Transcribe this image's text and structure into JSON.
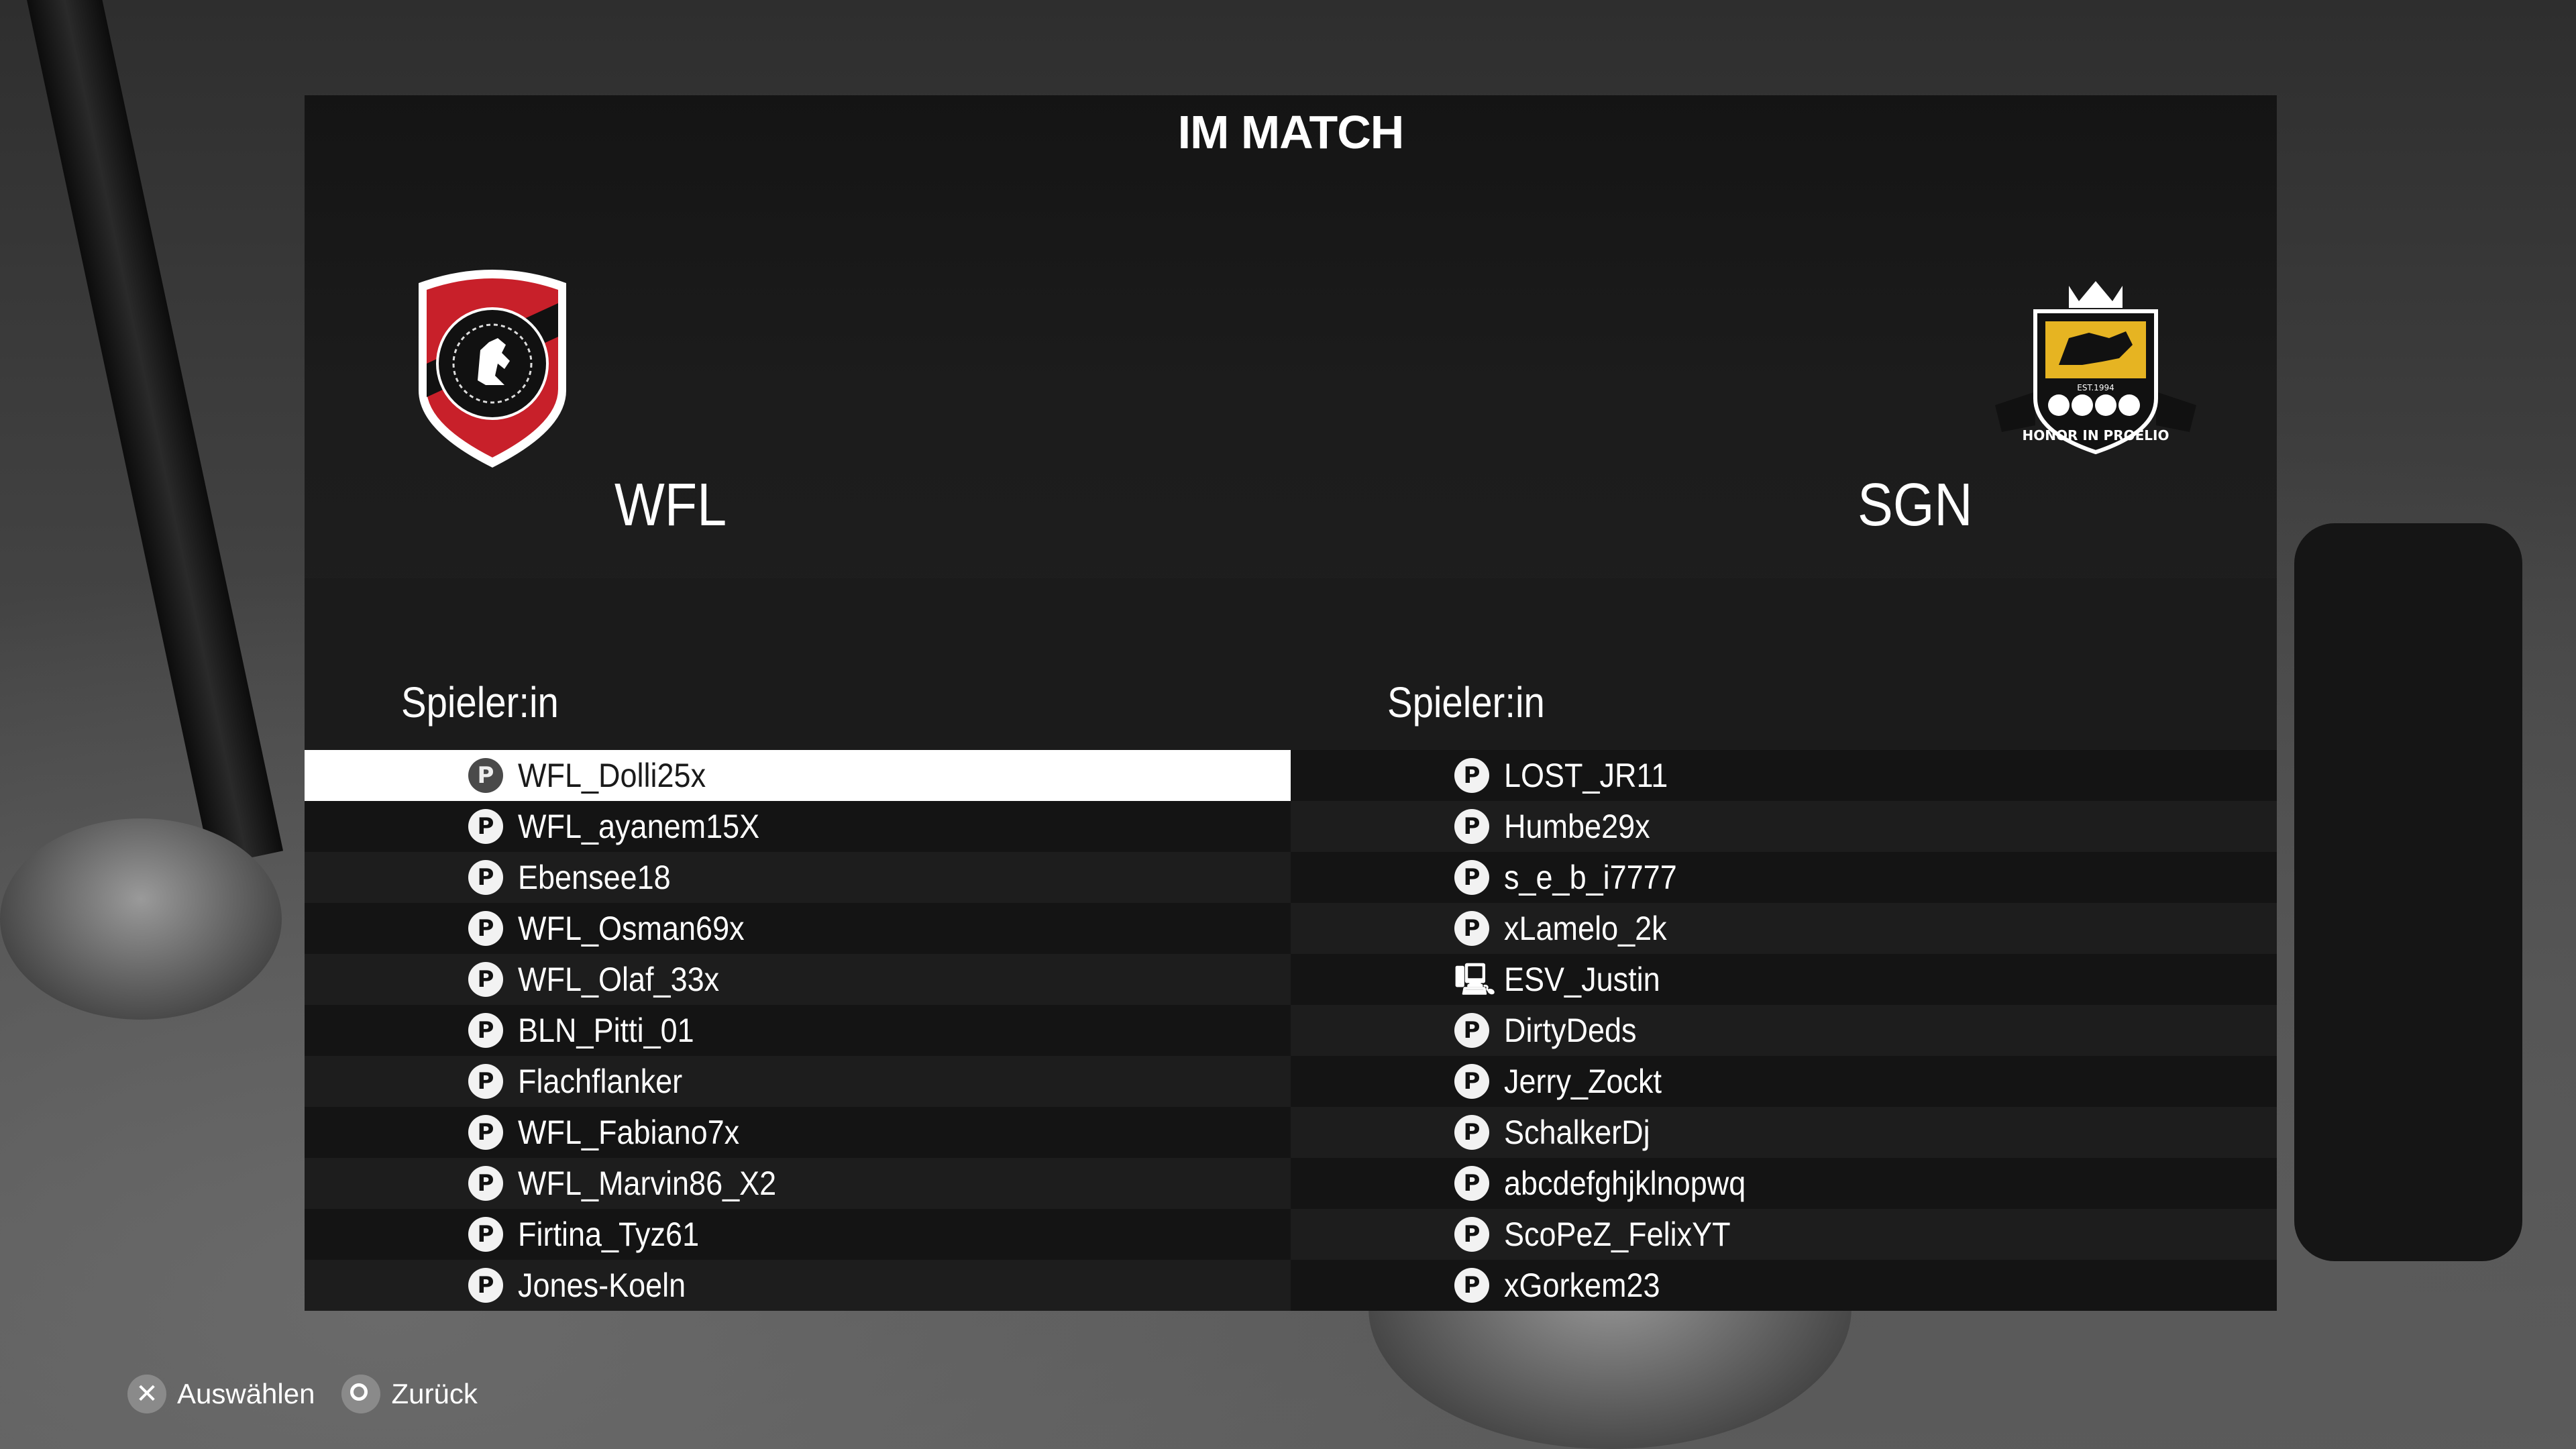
{
  "title": "IM MATCH",
  "home": {
    "name": "WFL",
    "crest_icon": "shield-lion-icon",
    "column_header": "Spieler:in",
    "players": [
      {
        "name": "WFL_Dolli25x",
        "platform": "playstation-icon",
        "platform_glyph": "P"
      },
      {
        "name": "WFL_ayanem15X",
        "platform": "playstation-icon",
        "platform_glyph": "P"
      },
      {
        "name": "Ebensee18",
        "platform": "playstation-icon",
        "platform_glyph": "P"
      },
      {
        "name": "WFL_Osman69x",
        "platform": "playstation-icon",
        "platform_glyph": "P"
      },
      {
        "name": "WFL_Olaf_33x",
        "platform": "playstation-icon",
        "platform_glyph": "P"
      },
      {
        "name": "BLN_Pitti_01",
        "platform": "playstation-icon",
        "platform_glyph": "P"
      },
      {
        "name": "Flachflanker",
        "platform": "playstation-icon",
        "platform_glyph": "P"
      },
      {
        "name": "WFL_Fabiano7x",
        "platform": "playstation-icon",
        "platform_glyph": "P"
      },
      {
        "name": "WFL_Marvin86_X2",
        "platform": "playstation-icon",
        "platform_glyph": "P"
      },
      {
        "name": "Firtina_Tyz61",
        "platform": "playstation-icon",
        "platform_glyph": "P"
      },
      {
        "name": "Jones-Koeln",
        "platform": "playstation-icon",
        "platform_glyph": "P"
      }
    ]
  },
  "away": {
    "name": "SGN",
    "crest_icon": "crown-lion-crest-icon",
    "crest_text": "HONOR IN PROELIO",
    "crest_year": "EST.1994",
    "column_header": "Spieler:in",
    "players": [
      {
        "name": "LOST_JR11",
        "platform": "playstation-icon",
        "platform_glyph": "P"
      },
      {
        "name": "Humbe29x",
        "platform": "playstation-icon",
        "platform_glyph": "P"
      },
      {
        "name": "s_e_b_i7777",
        "platform": "playstation-icon",
        "platform_glyph": "P"
      },
      {
        "name": "xLamelo_2k",
        "platform": "playstation-icon",
        "platform_glyph": "P"
      },
      {
        "name": "ESV_Justin",
        "platform": "pc-icon",
        "platform_glyph": "🖳"
      },
      {
        "name": "DirtyDeds",
        "platform": "playstation-icon",
        "platform_glyph": "P"
      },
      {
        "name": "Jerry_Zockt",
        "platform": "playstation-icon",
        "platform_glyph": "P"
      },
      {
        "name": "SchalkerDj",
        "platform": "playstation-icon",
        "platform_glyph": "P"
      },
      {
        "name": "abcdefghjklnopwq",
        "platform": "playstation-icon",
        "platform_glyph": "P"
      },
      {
        "name": "ScoPeZ_FelixYT",
        "platform": "playstation-icon",
        "platform_glyph": "P"
      },
      {
        "name": "xGorkem23",
        "platform": "playstation-icon",
        "platform_glyph": "P"
      }
    ]
  },
  "selected_index": 0,
  "footer": {
    "select_icon": "cross-button-icon",
    "select_label": "Auswählen",
    "back_icon": "circle-button-icon",
    "back_label": "Zurück"
  },
  "colors": {
    "panel": "#1b1b1b",
    "row_alt": "#141414",
    "selected_row": "#ffffff",
    "home_crest_red": "#c8202a",
    "away_crest_gold": "#e6b422"
  }
}
